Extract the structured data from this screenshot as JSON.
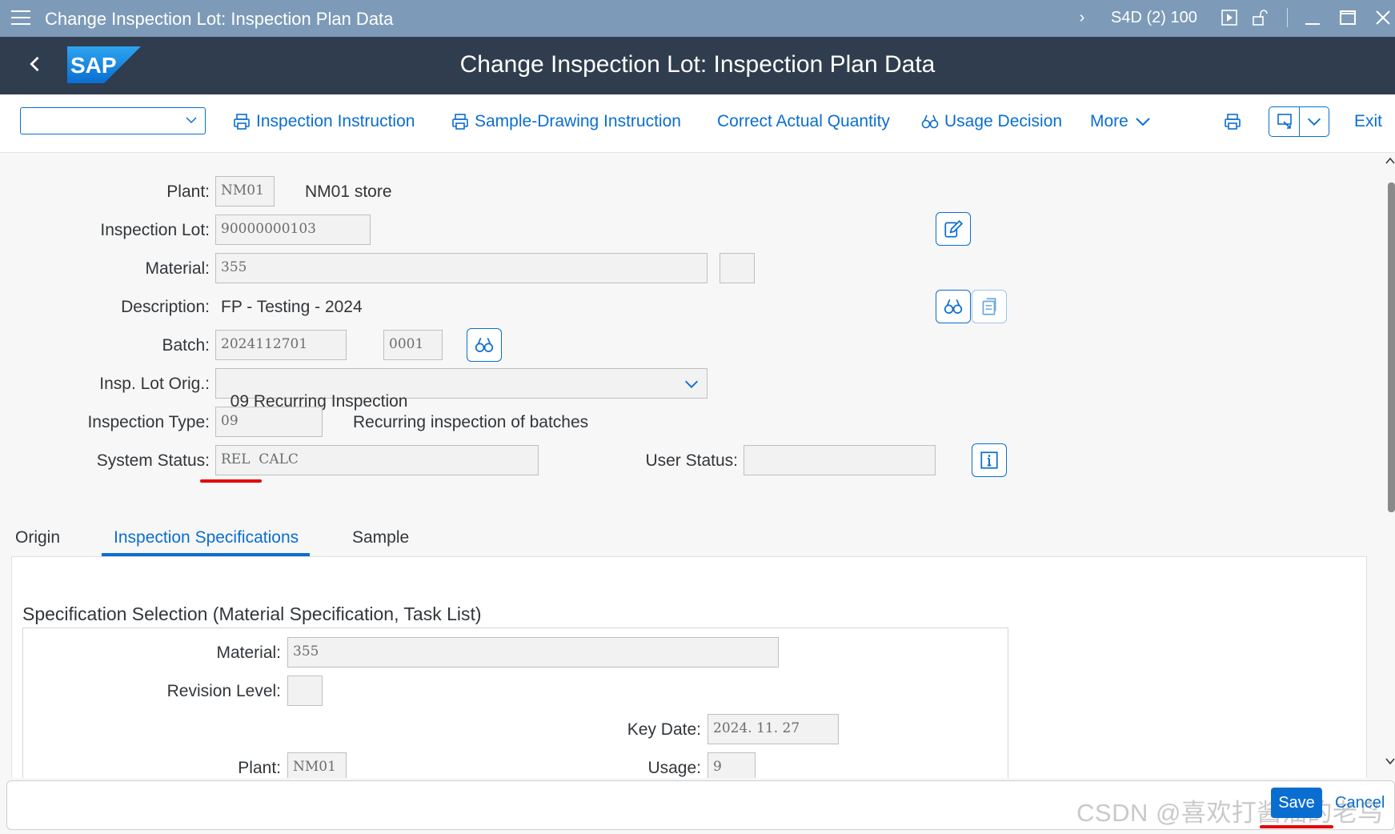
{
  "window": {
    "title": "Change Inspection Lot: Inspection Plan Data",
    "system": "S4D (2) 100"
  },
  "shell": {
    "logo_text": "SAP",
    "heading": "Change Inspection Lot: Inspection Plan Data"
  },
  "toolbar": {
    "command_value": "",
    "inspection_instruction": "Inspection Instruction",
    "sample_drawing_instruction": "Sample-Drawing Instruction",
    "correct_actual_quantity": "Correct Actual Quantity",
    "usage_decision": "Usage Decision",
    "more": "More",
    "exit": "Exit"
  },
  "header": {
    "plant_label": "Plant:",
    "plant_value": "NM01",
    "plant_text": "NM01 store",
    "lot_label": "Inspection Lot:",
    "lot_value": "90000000103",
    "material_label": "Material:",
    "material_value": "355",
    "material_extra": "",
    "description_label": "Description:",
    "description_value": "FP - Testing - 2024",
    "batch_label": "Batch:",
    "batch_value": "2024112701",
    "batch_split": "0001",
    "orig_label": "Insp. Lot Orig.:",
    "orig_value": "09 Recurring Inspection",
    "type_label": "Inspection Type:",
    "type_value": "09",
    "type_text": "Recurring inspection of batches",
    "sys_status_label": "System Status:",
    "sys_status_value": "REL  CALC",
    "user_status_label": "User Status:",
    "user_status_value": ""
  },
  "tabs": [
    {
      "label": "Origin",
      "active": false
    },
    {
      "label": "Inspection Specifications",
      "active": true
    },
    {
      "label": "Sample",
      "active": false
    }
  ],
  "spec": {
    "section_title": "Specification Selection (Material Specification, Task List)",
    "material_label": "Material:",
    "material_value": "355",
    "revision_label": "Revision Level:",
    "revision_value": "",
    "key_date_label": "Key Date:",
    "key_date_value": "2024. 11. 27",
    "plant_label": "Plant:",
    "plant_value": "NM01",
    "usage_label": "Usage:",
    "usage_value": "9"
  },
  "footer": {
    "save": "Save",
    "cancel": "Cancel",
    "watermark": "CSDN @喜欢打酱油的老鸟"
  },
  "colors": {
    "accent": "#0a6ed1",
    "shell": "#2f3d4e",
    "titlebar": "#7d9bb8",
    "highlight": "#e30000"
  }
}
